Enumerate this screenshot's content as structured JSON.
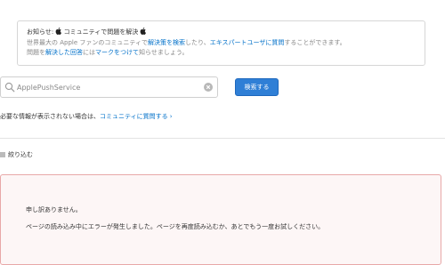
{
  "notice": {
    "title_prefix": "お知らせ: ",
    "title_main": " コミュニティで問題を解決 ",
    "line1_pre": "世界最大の Apple ファンのコミュニティで",
    "line1_link1": "解決策を検索",
    "line1_mid": "したり、",
    "line1_link2": "エキスパートユーザに質問",
    "line1_post": "することができます。",
    "line2_pre": "問題を",
    "line2_link1": "解決した回答",
    "line2_mid": "には",
    "line2_link2": "マークをつけて",
    "line2_post": "知らせましょう。"
  },
  "search": {
    "value": "ApplePushService",
    "button_label": "検索する"
  },
  "help": {
    "text": "必要な情報が表示されない場合は、",
    "link": "コミュニティに質問する ›"
  },
  "filter": {
    "label": "絞り込む"
  },
  "error": {
    "title": "申し訳ありません。",
    "message": "ページの読み込み中にエラーが発生しました。ページを再度読み込むか、あとでもう一度お試しください。"
  },
  "icons": {
    "apple": "apple-icon",
    "search": "search-icon",
    "clear": "clear-icon",
    "filter": "filter-icon"
  },
  "colors": {
    "link": "#0070c9",
    "button": "#2f7fd6",
    "error_border": "#e8a8a8",
    "error_background": "#fdf6f6"
  }
}
